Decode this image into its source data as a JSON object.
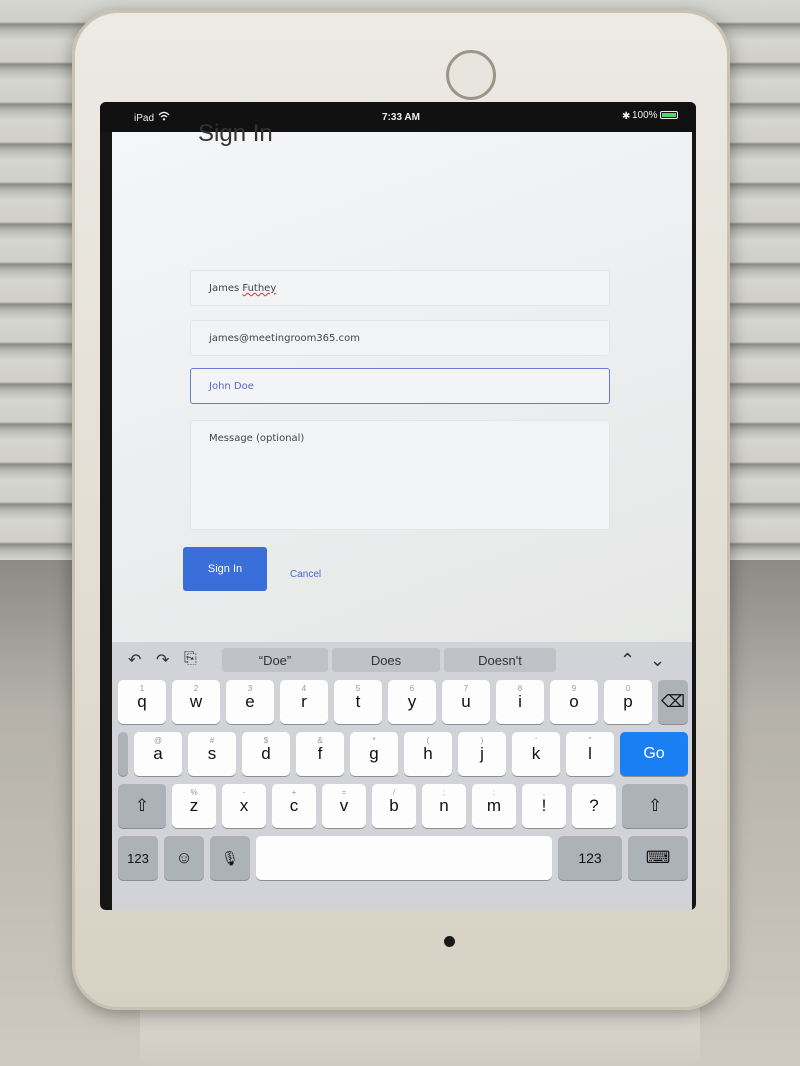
{
  "status_bar": {
    "device": "iPad",
    "time": "7:33 AM",
    "battery": "100%"
  },
  "form": {
    "title": "Sign In",
    "name_value": "James ",
    "name_value_misspelled": "Futhey",
    "email_value": "james@meetingroom365.com",
    "company_placeholder": "John Doe",
    "message_placeholder": "Message (optional)",
    "signin_label": "Sign In",
    "cancel_label": "Cancel"
  },
  "keyboard": {
    "suggestions": [
      "“Doe”",
      "Does",
      "Doesn't"
    ],
    "row1": [
      {
        "k": "q",
        "h": "1"
      },
      {
        "k": "w",
        "h": "2"
      },
      {
        "k": "e",
        "h": "3"
      },
      {
        "k": "r",
        "h": "4"
      },
      {
        "k": "t",
        "h": "5"
      },
      {
        "k": "y",
        "h": "6"
      },
      {
        "k": "u",
        "h": "7"
      },
      {
        "k": "i",
        "h": "8"
      },
      {
        "k": "o",
        "h": "9"
      },
      {
        "k": "p",
        "h": "0"
      }
    ],
    "row2": [
      {
        "k": "a",
        "h": "@"
      },
      {
        "k": "s",
        "h": "#"
      },
      {
        "k": "d",
        "h": "$"
      },
      {
        "k": "f",
        "h": "&"
      },
      {
        "k": "g",
        "h": "*"
      },
      {
        "k": "h",
        "h": "("
      },
      {
        "k": "j",
        "h": ")"
      },
      {
        "k": "k",
        "h": "'"
      },
      {
        "k": "l",
        "h": "\""
      }
    ],
    "row3": [
      {
        "k": "z",
        "h": "%"
      },
      {
        "k": "x",
        "h": "-"
      },
      {
        "k": "c",
        "h": "+"
      },
      {
        "k": "v",
        "h": "="
      },
      {
        "k": "b",
        "h": "/"
      },
      {
        "k": "n",
        "h": ";"
      },
      {
        "k": "m",
        "h": ":"
      },
      {
        "k": "!",
        "h": ","
      },
      {
        "k": "?",
        "h": "."
      }
    ],
    "go_label": "Go",
    "numbers_label": "123",
    "undo_icon": "↶",
    "redo_icon": "↷",
    "paste_icon": "⎘",
    "shift_icon": "⇧",
    "backspace_icon": "⌫",
    "emoji_icon": "☺",
    "mic_icon": "🎙",
    "hide_keyboard_icon": "⌨",
    "up_icon": "⌃",
    "down_icon": "⌄"
  }
}
